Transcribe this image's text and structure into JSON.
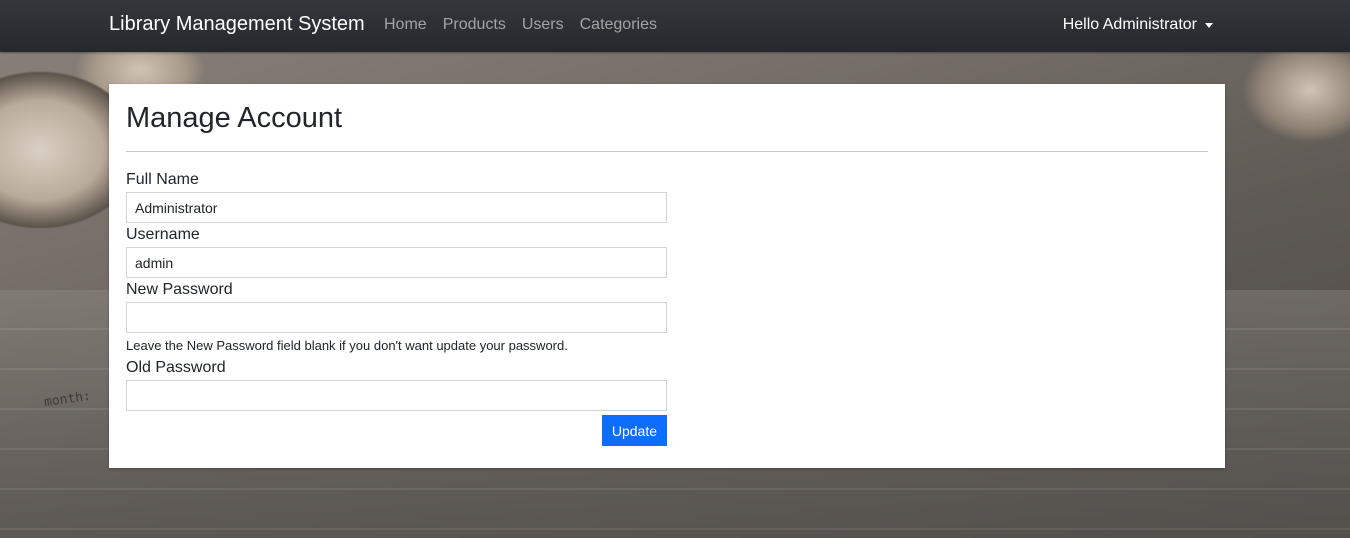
{
  "navbar": {
    "brand": "Library Management System",
    "links": [
      "Home",
      "Products",
      "Users",
      "Categories"
    ],
    "user_menu": "Hello Administrator"
  },
  "background": {
    "paper_text": "month:"
  },
  "page": {
    "title": "Manage Account"
  },
  "form": {
    "full_name_label": "Full Name",
    "full_name_value": "Administrator",
    "username_label": "Username",
    "username_value": "admin",
    "new_password_label": "New Password",
    "new_password_value": "",
    "new_password_help": "Leave the New Password field blank if you don't want update your password.",
    "old_password_label": "Old Password",
    "old_password_value": "",
    "update_label": "Update"
  },
  "colors": {
    "navbar_bg": "#2b2f33",
    "primary": "#0d6efd"
  }
}
